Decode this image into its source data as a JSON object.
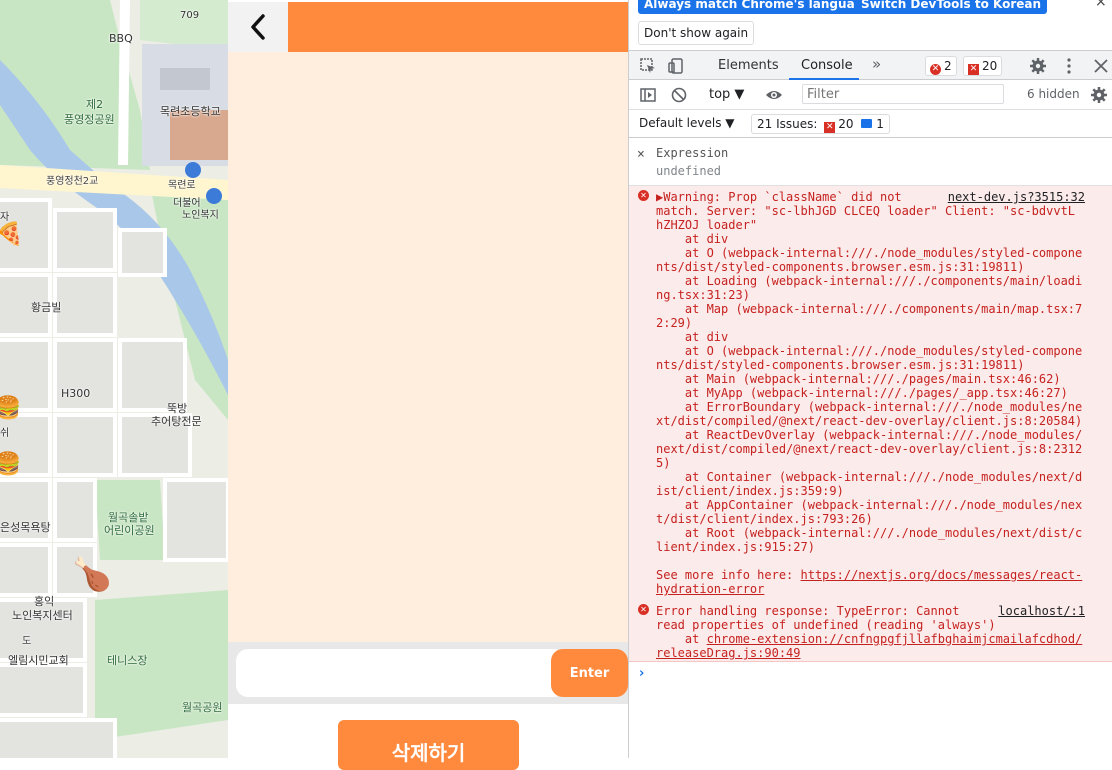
{
  "map": {
    "labels": {
      "bbq": "BBQ",
      "num709": "709",
      "park2_line1": "제2",
      "park2_line2": "풍영정공원",
      "school": "목련초등학교",
      "bridge": "풍영정천2교",
      "mokryeon": "목련로",
      "welfare_line1": "더불어",
      "welfare_line2": "노인복지",
      "hwanggeum": "황금빌",
      "h300": "H300",
      "ttukbang_line1": "뚝방",
      "ttukbang_line2": "추어탕전문",
      "wolgok_line1": "월곡솔밭",
      "wolgok_line2": "어린이공원",
      "sauna": "은성목욕탕",
      "hongik_line1": "홍익",
      "hongik_line2": "노인복지센터",
      "church": "엘림시민교회",
      "tennis": "테니스장",
      "wolgokpark": "월곡공원",
      "left_ja": "자",
      "left_swi": "쉬",
      "road_do": "도"
    },
    "markers": [
      "pizza-icon",
      "burger-icon",
      "burger-icon",
      "fried-chicken-icon"
    ]
  },
  "app": {
    "back_symbol": "<",
    "input_placeholder": "",
    "enter_label": "Enter",
    "delete_label": "삭제하기"
  },
  "devtools": {
    "lang_match": "Always match Chrome's language",
    "lang_switch": "Switch DevTools to Korean",
    "dont_show": "Don't show again",
    "close_symbol": "×",
    "tabs": {
      "elements": "Elements",
      "console": "Console",
      "more": "»"
    },
    "error_count": "2",
    "issue_count": "20",
    "context": "top ▼",
    "filter_placeholder": "Filter",
    "hidden": "6 hidden",
    "levels": "Default levels ▼",
    "issues_label": "21 Issues:",
    "issues_errors": "20",
    "issues_info": "1",
    "expression_label": "Expression",
    "expression_value": "undefined",
    "error1": {
      "source": "next-dev.js?3515:32",
      "text": "▶Warning: Prop `className` did not          \nmatch. Server: \"sc-lbhJGD CLCEQ loader\" Client: \"sc-bdvvtL hZHZOJ loader\"\n    at div\n    at O (webpack-internal:///./node_modules/styled-components/dist/styled-components.browser.esm.js:31:19811)\n    at Loading (webpack-internal:///./components/main/loading.tsx:31:23)\n    at Map (webpack-internal:///./components/main/map.tsx:72:29)\n    at div\n    at O (webpack-internal:///./node_modules/styled-components/dist/styled-components.browser.esm.js:31:19811)\n    at Main (webpack-internal:///./pages/main.tsx:46:62)\n    at MyApp (webpack-internal:///./pages/_app.tsx:46:27)\n    at ErrorBoundary (webpack-internal:///./node_modules/next/dist/compiled/@next/react-dev-overlay/client.js:8:20584)\n    at ReactDevOverlay (webpack-internal:///./node_modules/next/dist/compiled/@next/react-dev-overlay/client.js:8:23125)\n    at Container (webpack-internal:///./node_modules/next/dist/client/index.js:359:9)\n    at AppContainer (webpack-internal:///./node_modules/next/dist/client/index.js:793:26)\n    at Root (webpack-internal:///./node_modules/next/dist/client/index.js:915:27)\n\nSee more info here: ",
      "link": "https://nextjs.org/docs/messages/react-hydration-error"
    },
    "error2": {
      "source": "localhost/:1",
      "text": "Error handling response: TypeError: Cannot\nread properties of undefined (reading 'always')\n    at ",
      "link": "chrome-extension://cnfngpgfjllafbghaimjcmailafcdhod/releaseDrag.js:90:49"
    },
    "prompt": "›"
  },
  "colors": {
    "accent": "#ff8a3d",
    "chat_bg": "#ffeddd",
    "devtools_blue": "#1a73e8",
    "error_red": "#d93025"
  }
}
